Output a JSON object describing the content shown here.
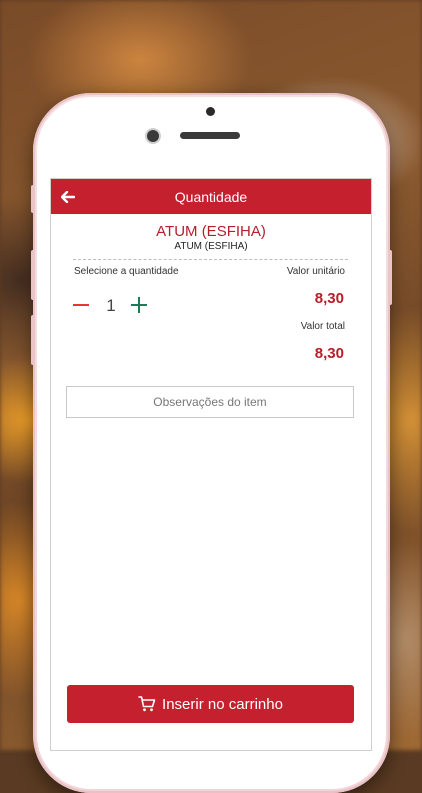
{
  "header": {
    "title": "Quantidade",
    "back_icon": "arrow-left-icon"
  },
  "product": {
    "name": "ATUM (ESFIHA)",
    "subtitle": "ATUM (ESFIHA)"
  },
  "quantity": {
    "label": "Selecione a quantidade",
    "value": "1",
    "minus_icon": "minus-icon",
    "plus_icon": "plus-icon"
  },
  "pricing": {
    "unit_label": "Valor unitário",
    "unit_value": "8,30",
    "total_label": "Valor total",
    "total_value": "8,30"
  },
  "notes": {
    "placeholder": "Observações do item",
    "value": ""
  },
  "cart_button": {
    "label": "Inserir no carrinho",
    "icon": "cart-icon"
  },
  "colors": {
    "brand_red": "#c4202e",
    "price_red": "#b81d2a",
    "minus": "#e03a2f",
    "plus": "#1f7a5a"
  }
}
